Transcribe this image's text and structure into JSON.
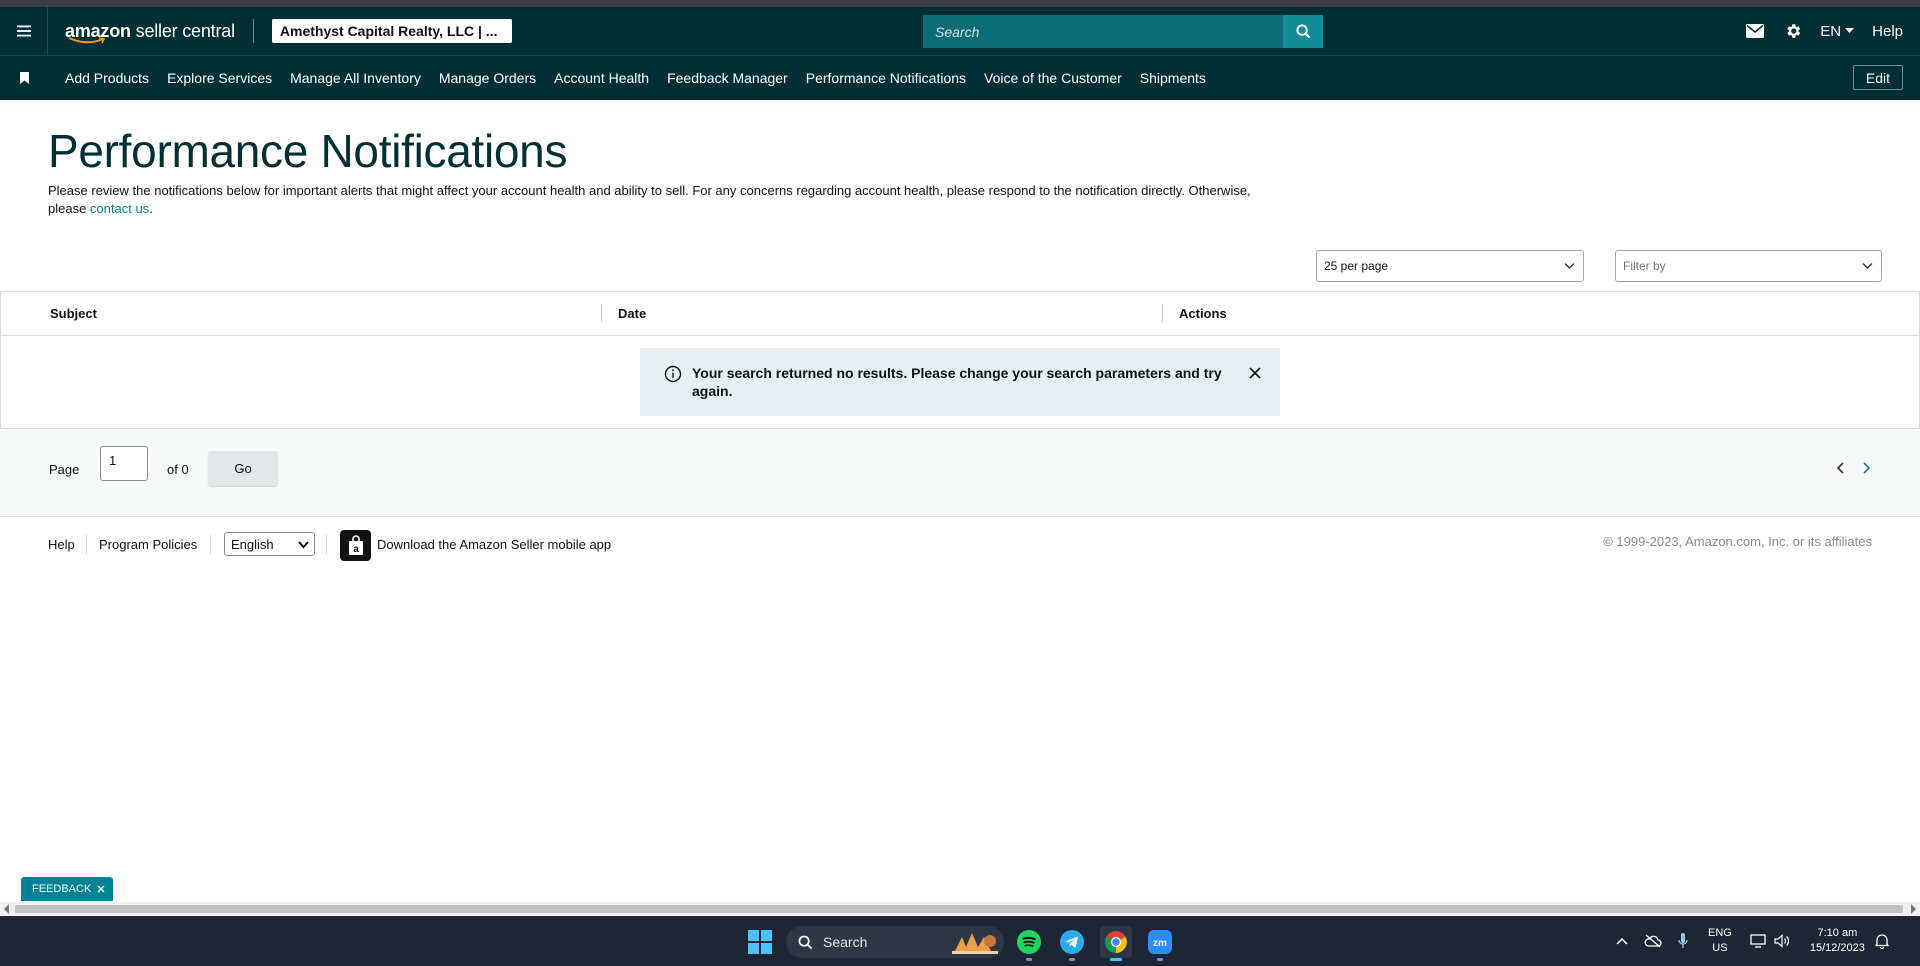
{
  "header": {
    "logo_main": "amazon",
    "logo_sub": "seller central",
    "account": "Amethyst Capital Realty, LLC | ...",
    "search_placeholder": "Search",
    "language": "EN",
    "help": "Help",
    "icons": [
      "menu-icon",
      "mail-icon",
      "gear-icon",
      "search-icon"
    ]
  },
  "nav": {
    "items": [
      "Add Products",
      "Explore Services",
      "Manage All Inventory",
      "Manage Orders",
      "Account Health",
      "Feedback Manager",
      "Performance Notifications",
      "Voice of the Customer",
      "Shipments"
    ],
    "edit": "Edit"
  },
  "page": {
    "title": "Performance Notifications",
    "intro_text": "Please review the notifications below for important alerts that might affect your account health and ability to sell. For any concerns regarding account health, please respond to the notification directly. Otherwise, please ",
    "intro_link": "contact us",
    "intro_end": "."
  },
  "controls": {
    "per_page": "25 per page",
    "filter_placeholder": "Filter by"
  },
  "table": {
    "columns": [
      "Subject",
      "Date",
      "Actions"
    ],
    "rows": [],
    "empty_message": "Your search returned no results. Please change your search parameters and try again."
  },
  "pagination": {
    "page_label": "Page",
    "current_page": "1",
    "of_label": "of 0",
    "go": "Go"
  },
  "footer": {
    "help": "Help",
    "program_policies": "Program Policies",
    "language": "English",
    "app_download": "Download the Amazon Seller mobile app",
    "copyright": "© 1999-2023, Amazon.com, Inc. or its affiliates"
  },
  "feedback": {
    "label": "FEEDBACK"
  },
  "taskbar": {
    "search": "Search",
    "lang_top": "ENG",
    "lang_bottom": "US",
    "time": "7:10 am",
    "date": "15/12/2023",
    "apps": [
      "spotify-icon",
      "telegram-icon",
      "chrome-icon",
      "zoom-icon"
    ]
  },
  "colors": {
    "header_bg": "#002f36",
    "accent": "#008296",
    "search_bg": "#0c6b74",
    "alert_bg": "#e3eff0"
  }
}
